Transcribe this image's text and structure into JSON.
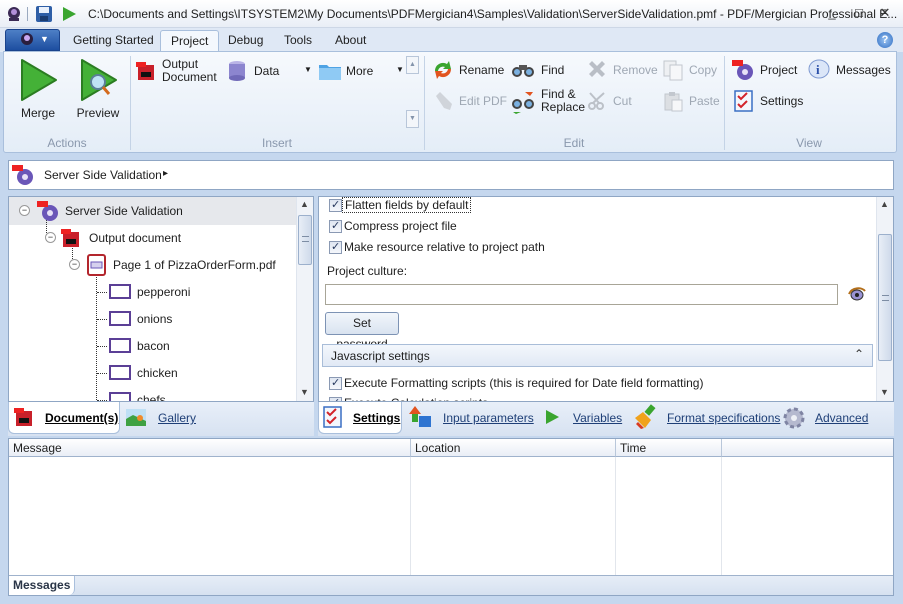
{
  "window": {
    "title": "C:\\Documents and Settings\\ITSYSTEM2\\My Documents\\PDFMergician4\\Samples\\Validation\\ServerSideValidation.pmf - PDF/Mergician Professional E...",
    "minimize": "_",
    "maximize": "□",
    "close": "✕"
  },
  "ribbon_tabs": [
    {
      "label": "Getting Started"
    },
    {
      "label": "Project",
      "active": true
    },
    {
      "label": "Debug"
    },
    {
      "label": "Tools"
    },
    {
      "label": "About"
    }
  ],
  "help_icon": "?",
  "ribbon": {
    "actions": {
      "label": "Actions",
      "merge": "Merge",
      "preview": "Preview"
    },
    "insert": {
      "label": "Insert",
      "output_document_l1": "Output",
      "output_document_l2": "Document",
      "data": "Data",
      "more": "More"
    },
    "edit": {
      "label": "Edit",
      "rename": "Rename",
      "find": "Find",
      "remove": "Remove",
      "copy": "Copy",
      "edit_pdf": "Edit PDF",
      "find_replace_l1": "Find &",
      "find_replace_l2": "Replace",
      "cut": "Cut",
      "paste": "Paste"
    },
    "view": {
      "label": "View",
      "project": "Project",
      "messages": "Messages",
      "settings": "Settings"
    }
  },
  "breadcrumb": {
    "label": "Server Side Validation",
    "arrow": "▸"
  },
  "tree": {
    "root": "Server Side Validation",
    "output": "Output document",
    "page": "Page 1 of PizzaOrderForm.pdf",
    "fields": [
      "pepperoni",
      "onions",
      "bacon",
      "chicken",
      "chefs"
    ]
  },
  "left_tabs": {
    "documents": "Document(s)",
    "gallery": "Gallery"
  },
  "settings": {
    "flatten": {
      "label": "Flatten fields by default",
      "checked": true
    },
    "compress": {
      "label": "Compress project file",
      "checked": true
    },
    "relative": {
      "label": "Make resource relative to project path",
      "checked": true
    },
    "culture_label": "Project culture:",
    "culture_value": "",
    "set_password": "Set password",
    "js_section": "Javascript settings",
    "execute_formatting": {
      "label": "Execute Formatting scripts (this is required for Date field formatting)",
      "checked": true
    },
    "execute_calc": {
      "label": "Execute Calculation scripts",
      "checked": true
    }
  },
  "right_tabs": {
    "settings": "Settings",
    "input_parameters": "Input parameters",
    "variables": "Variables",
    "format_specifications": "Format specifications",
    "advanced": "Advanced"
  },
  "messages": {
    "columns": [
      "Message",
      "Location",
      "Time",
      ""
    ],
    "rows": [],
    "tab": "Messages"
  }
}
